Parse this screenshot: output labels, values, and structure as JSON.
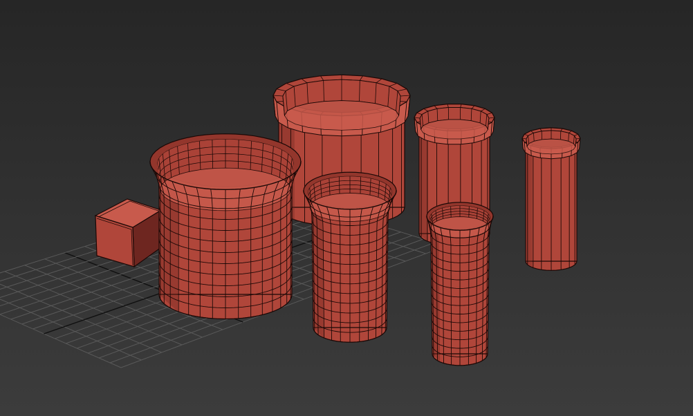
{
  "viewport": {
    "kind": "3d-perspective-viewport",
    "shading": "wireframe-on-shaded",
    "background_top": "#262626",
    "background_bottom": "#3c3c3c",
    "grid_color": "#595959",
    "grid_axis_color": "#101010"
  },
  "objects": [
    {
      "name": "box",
      "type": "box"
    },
    {
      "name": "wide-flared-cup",
      "type": "cylinder"
    },
    {
      "name": "large-beveled-pot",
      "type": "cylinder"
    },
    {
      "name": "medium-beveled-tube",
      "type": "cylinder"
    },
    {
      "name": "small-beveled-tube",
      "type": "cylinder"
    },
    {
      "name": "medium-flared-cup",
      "type": "cylinder"
    },
    {
      "name": "small-flared-cup",
      "type": "cylinder"
    }
  ],
  "material": {
    "base": "#b0463a",
    "shadow": "#6e2620",
    "light": "#c85a4c",
    "rim_inner": "#93362c",
    "wire": "#1a0806"
  }
}
